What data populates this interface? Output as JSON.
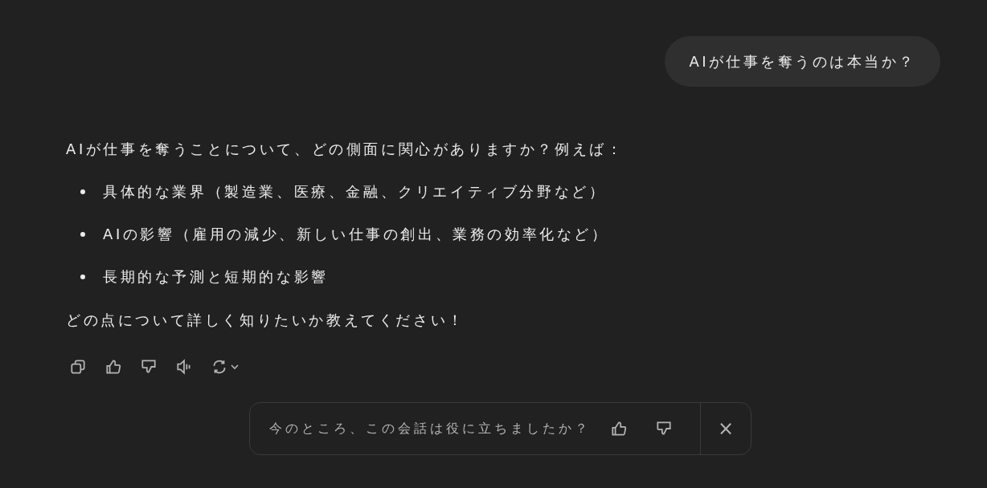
{
  "user_message": "AIが仕事を奪うのは本当か？",
  "assistant": {
    "intro": "AIが仕事を奪うことについて、どの側面に関心がありますか？例えば：",
    "bullets": [
      "具体的な業界（製造業、医療、金融、クリエイティブ分野など）",
      "AIの影響（雇用の減少、新しい仕事の創出、業務の効率化など）",
      "長期的な予測と短期的な影響"
    ],
    "closing": "どの点について詳しく知りたいか教えてください！"
  },
  "feedback": {
    "question": "今のところ、この会話は役に立ちましたか？",
    "close": "×"
  }
}
